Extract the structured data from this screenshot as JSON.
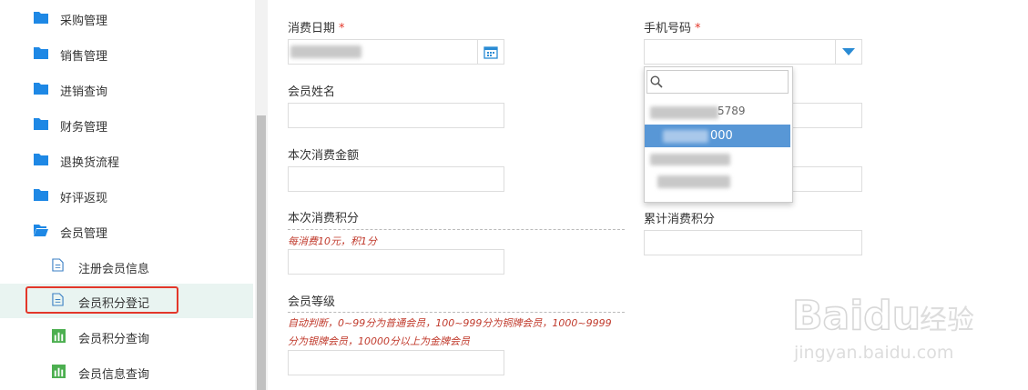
{
  "sidebar": {
    "items": [
      {
        "label": "采购管理",
        "icon": "folder-icon"
      },
      {
        "label": "销售管理",
        "icon": "folder-icon"
      },
      {
        "label": "进销查询",
        "icon": "folder-icon"
      },
      {
        "label": "财务管理",
        "icon": "folder-icon"
      },
      {
        "label": "退换货流程",
        "icon": "folder-icon"
      },
      {
        "label": "好评返现",
        "icon": "folder-icon"
      },
      {
        "label": "会员管理",
        "icon": "folder-open-icon"
      }
    ],
    "subitems": [
      {
        "label": "注册会员信息",
        "icon": "document-icon"
      },
      {
        "label": "会员积分登记",
        "icon": "document-icon"
      },
      {
        "label": "会员积分查询",
        "icon": "bar-chart-icon"
      },
      {
        "label": "会员信息查询",
        "icon": "bar-chart-icon"
      }
    ]
  },
  "form": {
    "date_label": "消费日期",
    "phone_label": "手机号码",
    "required_mark": "*",
    "name_label": "会员姓名",
    "amount_label": "本次消费金额",
    "points_label": "本次消费积分",
    "points_hint": "每消费10元，积1分",
    "total_points_label": "累计消费积分",
    "level_label": "会员等级",
    "level_hint_line1": "自动判断，0~99分为普通会员，100~999分为铜牌会员，1000~9999",
    "level_hint_line2": "分为银牌会员，10000分以上为金牌会员"
  },
  "dropdown": {
    "option_partial_1": "5789",
    "option_selected_partial": "000"
  },
  "watermark": {
    "brand": "Baidu",
    "sub": "经验",
    "url": "jingyan.baidu.com"
  },
  "colors": {
    "accent_blue": "#2a8bd4",
    "selected_blue": "#5897d6",
    "required_red": "#e3372a",
    "active_bg": "#e9f4f1"
  }
}
